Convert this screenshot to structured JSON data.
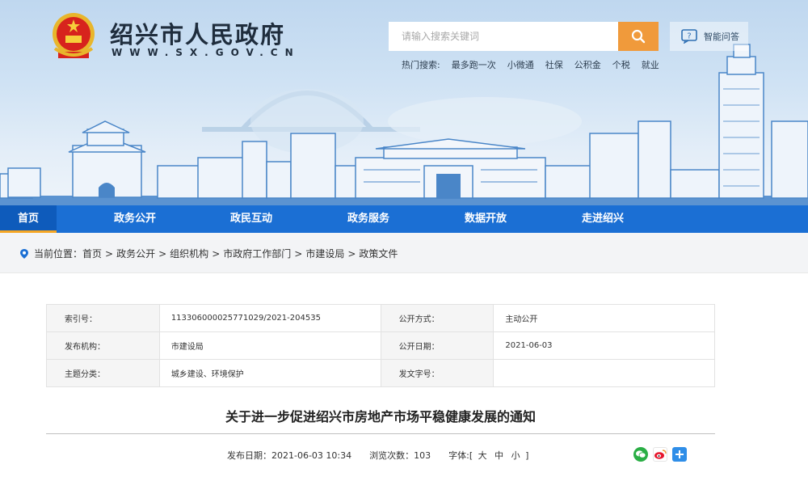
{
  "header": {
    "site_title": "绍兴市人民政府",
    "site_url": "WWW.SX.GOV.CN",
    "search_placeholder": "请输入搜索关键词",
    "qa_label": "智能问答",
    "hot_label": "热门搜索:",
    "hot_words": [
      "最多跑一次",
      "小微通",
      "社保",
      "公积金",
      "个税",
      "就业"
    ]
  },
  "nav": {
    "items": [
      "首页",
      "政务公开",
      "政民互动",
      "政务服务",
      "数据开放",
      "走进绍兴"
    ],
    "active": "首页"
  },
  "breadcrumb": {
    "label": "当前位置：",
    "items": [
      "首页",
      "政务公开",
      "组织机构",
      "市政府工作部门",
      "市建设局",
      "政策文件"
    ]
  },
  "meta": {
    "index_label": "索引号：",
    "index_value": "113306000025771029/2021-204535",
    "open_mode_label": "公开方式：",
    "open_mode_value": "主动公开",
    "org_label": "发布机构：",
    "org_value": "市建设局",
    "open_date_label": "公开日期：",
    "open_date_value": "2021-06-03",
    "topic_label": "主题分类：",
    "topic_value": "城乡建设、环境保护",
    "doc_no_label": "发文字号：",
    "doc_no_value": ""
  },
  "article": {
    "title": "关于进一步促进绍兴市房地产市场平稳健康发展的通知",
    "publish_date": "发布日期：2021-06-03 10:34",
    "views": "浏览次数：103",
    "font_label": "字体:[",
    "font_large": "大",
    "font_medium": "中",
    "font_small": "小",
    "font_end": "]"
  },
  "colors": {
    "nav_bg": "#1b6fd4",
    "nav_active": "#0e5bbb",
    "accent_orange": "#f09a3b"
  }
}
